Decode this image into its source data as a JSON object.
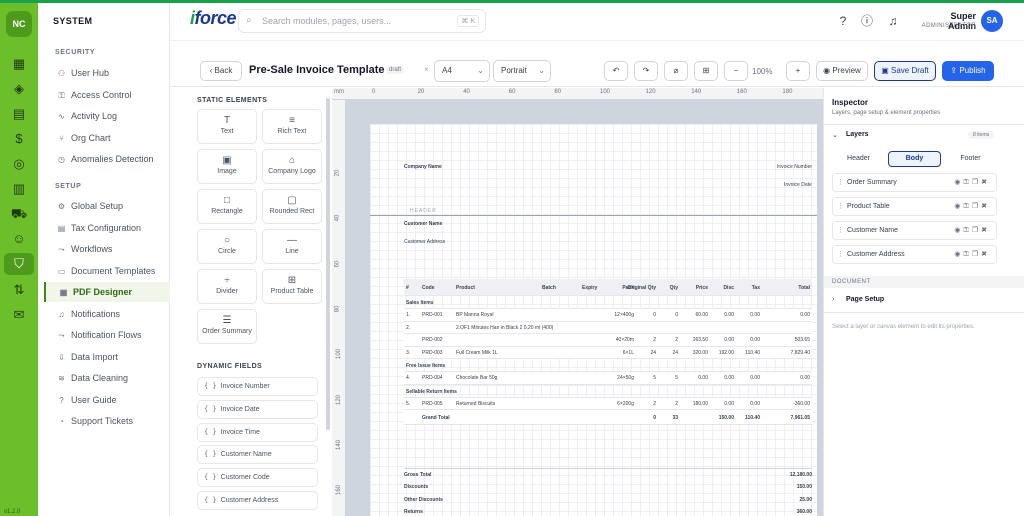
{
  "app": {
    "badge": "NC",
    "version": "v1.2.0"
  },
  "sidebar": {
    "title": "SYSTEM",
    "security_label": "SECURITY",
    "security": [
      {
        "label": "User Hub",
        "icon": "users-icon"
      },
      {
        "label": "Access Control",
        "icon": "lock-icon"
      },
      {
        "label": "Activity Log",
        "icon": "activity-icon"
      },
      {
        "label": "Org Chart",
        "icon": "org-icon"
      },
      {
        "label": "Anomalies Detection",
        "icon": "alert-icon"
      }
    ],
    "setup_label": "SETUP",
    "setup": [
      {
        "label": "Global Setup",
        "icon": "gear-icon"
      },
      {
        "label": "Tax Configuration",
        "icon": "receipt-icon"
      },
      {
        "label": "Workflows",
        "icon": "flow-icon"
      },
      {
        "label": "Document Templates",
        "icon": "file-icon"
      },
      {
        "label": "PDF Designer",
        "icon": "pdf-icon",
        "active": true
      },
      {
        "label": "Notifications",
        "icon": "bell-icon"
      },
      {
        "label": "Notification Flows",
        "icon": "flow-icon"
      },
      {
        "label": "Data Import",
        "icon": "import-icon"
      },
      {
        "label": "Data Cleaning",
        "icon": "broom-icon"
      },
      {
        "label": "User Guide",
        "icon": "help-icon"
      },
      {
        "label": "Support Tickets",
        "icon": "ticket-icon"
      }
    ]
  },
  "header": {
    "logo": "force",
    "logo_i": "i",
    "search_placeholder": "Search modules, pages, users...",
    "search_kbd": "⌘ K",
    "user_name": "Super Admin",
    "user_role": "ADMINISTRATOR",
    "avatar": "SA"
  },
  "toolbar": {
    "back": "Back",
    "title": "Pre-Sale Invoice Template",
    "status": "draft",
    "paper": "A4",
    "orientation": "Portrait",
    "zoom": "100%",
    "preview": "Preview",
    "save": "Save Draft",
    "publish": "Publish"
  },
  "palette": {
    "static_label": "STATIC ELEMENTS",
    "tiles": [
      {
        "label": "Text",
        "icon": "T"
      },
      {
        "label": "Rich Text",
        "icon": "≡"
      },
      {
        "label": "Image",
        "icon": "▣"
      },
      {
        "label": "Company Logo",
        "icon": "⌂"
      },
      {
        "label": "Rectangle",
        "icon": "□"
      },
      {
        "label": "Rounded Rect",
        "icon": "▢"
      },
      {
        "label": "Circle",
        "icon": "○"
      },
      {
        "label": "Line",
        "icon": "—"
      },
      {
        "label": "Divider",
        "icon": "÷"
      },
      {
        "label": "Product Table",
        "icon": "⊞"
      },
      {
        "label": "Order Summary",
        "icon": "☰"
      }
    ],
    "dynamic_label": "DYNAMIC FIELDS",
    "fields": [
      "Invoice Number",
      "Invoice Date",
      "Invoice Time",
      "Customer Name",
      "Customer Code",
      "Customer Address"
    ]
  },
  "ruler": {
    "unit": "mm",
    "top": [
      "0",
      "20",
      "40",
      "60",
      "80",
      "100",
      "120",
      "140",
      "160",
      "180"
    ],
    "left": [
      "20",
      "40",
      "60",
      "80",
      "100",
      "120",
      "140",
      "160"
    ]
  },
  "document": {
    "company_name": "Company Name",
    "invoice_number": "Invoice Number",
    "invoice_date": "Invoice Date",
    "header_band": "HEADER",
    "customer_name": "Customer Name",
    "customer_address": "Customer Address",
    "columns": [
      "#",
      "Code",
      "Product",
      "Batch",
      "Expiry",
      "Pack",
      "Original Qty",
      "Qty",
      "Price",
      "Disc",
      "Tax",
      "Total"
    ],
    "rows": [
      {
        "type": "section",
        "text": "Sales Items"
      },
      {
        "type": "row",
        "cells": [
          "1.",
          "PRD-001",
          "BP Manna Royal",
          "",
          "",
          "12×400g",
          "0",
          "0",
          "60.00",
          "0.00",
          "0.00",
          "0.00"
        ]
      },
      {
        "type": "row",
        "cells": [
          "2.",
          "",
          "2.OF1 Minutes Han in Black 2 0.20 ml (400)",
          "",
          "",
          "",
          "",
          "",
          "",
          "",
          "",
          ""
        ]
      },
      {
        "type": "row",
        "cells": [
          "",
          "PRD-002",
          "",
          "",
          "",
          "40×20m",
          "2",
          "2",
          "263.50",
          "0.00",
          "0.00",
          "503.65"
        ]
      },
      {
        "type": "row",
        "cells": [
          "3.",
          "PRD-003",
          "Full Cream Milk 1L",
          "",
          "",
          "6×1L",
          "24",
          "24",
          "320.00",
          "192.00",
          "110.40",
          "7,829.40"
        ]
      },
      {
        "type": "section",
        "text": "Free Issue Items"
      },
      {
        "type": "row",
        "cells": [
          "4.",
          "PRD-004",
          "Chocolate Bar 50g",
          "",
          "",
          "24×50g",
          "5",
          "5",
          "0.00",
          "0.00",
          "0.00",
          "0.00"
        ]
      },
      {
        "type": "section",
        "text": "Sellable Return Items"
      },
      {
        "type": "row",
        "cells": [
          "5.",
          "PRD-005",
          "Returned Biscuits",
          "",
          "",
          "6×200g",
          "2",
          "2",
          "180.00",
          "0.00",
          "0.00",
          "-360.00"
        ]
      },
      {
        "type": "total",
        "cells": [
          "",
          "Grand Total",
          "",
          "",
          "",
          "",
          "0",
          "33",
          "",
          "150.00",
          "110.40",
          "7,961.05"
        ]
      }
    ],
    "summary": [
      {
        "label": "Gross Total",
        "value": "12,180.00"
      },
      {
        "label": "Discounts",
        "value": "150.00"
      },
      {
        "label": "Other Discounts",
        "value": "25.00"
      },
      {
        "label": "Returns",
        "value": "360.00"
      }
    ]
  },
  "inspector": {
    "title": "Inspector",
    "subtitle": "Layers, page setup & element properties",
    "layers_label": "Layers",
    "layers_count": "8 items",
    "tabs": [
      {
        "label": "Header"
      },
      {
        "label": "Body",
        "active": true
      },
      {
        "label": "Footer"
      }
    ],
    "layers": [
      "Order Summary",
      "Product Table",
      "Customer Name",
      "Customer Address"
    ],
    "document_label": "DOCUMENT",
    "page_setup": "Page Setup",
    "hint": "Select a layer or canvas element to edit its properties."
  }
}
